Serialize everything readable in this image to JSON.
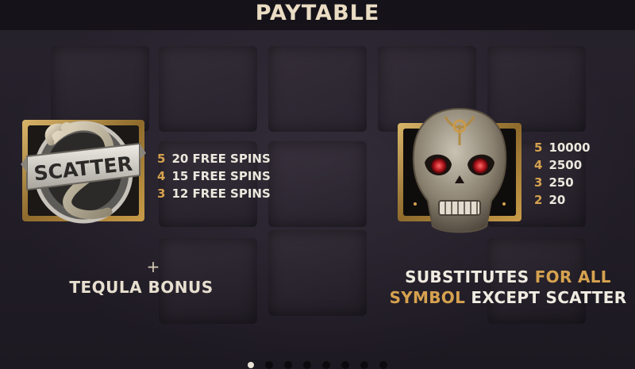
{
  "header": {
    "title": "PAYTABLE"
  },
  "scatter": {
    "label": "SCATTER",
    "payouts": [
      {
        "count": "5",
        "award": "20 FREE SPINS"
      },
      {
        "count": "4",
        "award": "15 FREE SPINS"
      },
      {
        "count": "3",
        "award": "12 FREE SPINS"
      }
    ],
    "plus": "+",
    "bonus": "TEQULA BONUS"
  },
  "wild": {
    "payouts": [
      {
        "count": "5",
        "award": "10000"
      },
      {
        "count": "4",
        "award": "2500"
      },
      {
        "count": "3",
        "award": "250"
      },
      {
        "count": "2",
        "award": "20"
      }
    ],
    "desc_line1_a": "SUBSTITUTES",
    "desc_line1_b": "FOR ALL",
    "desc_line2_a": "SYMBOL",
    "desc_line2_b": "EXCEPT SCATTER"
  },
  "pager": {
    "pages": 8,
    "active_index": 0
  },
  "colors": {
    "accent_gold": "#d6a24f",
    "text_light": "#ece7dd",
    "header_bg": "#151219"
  }
}
